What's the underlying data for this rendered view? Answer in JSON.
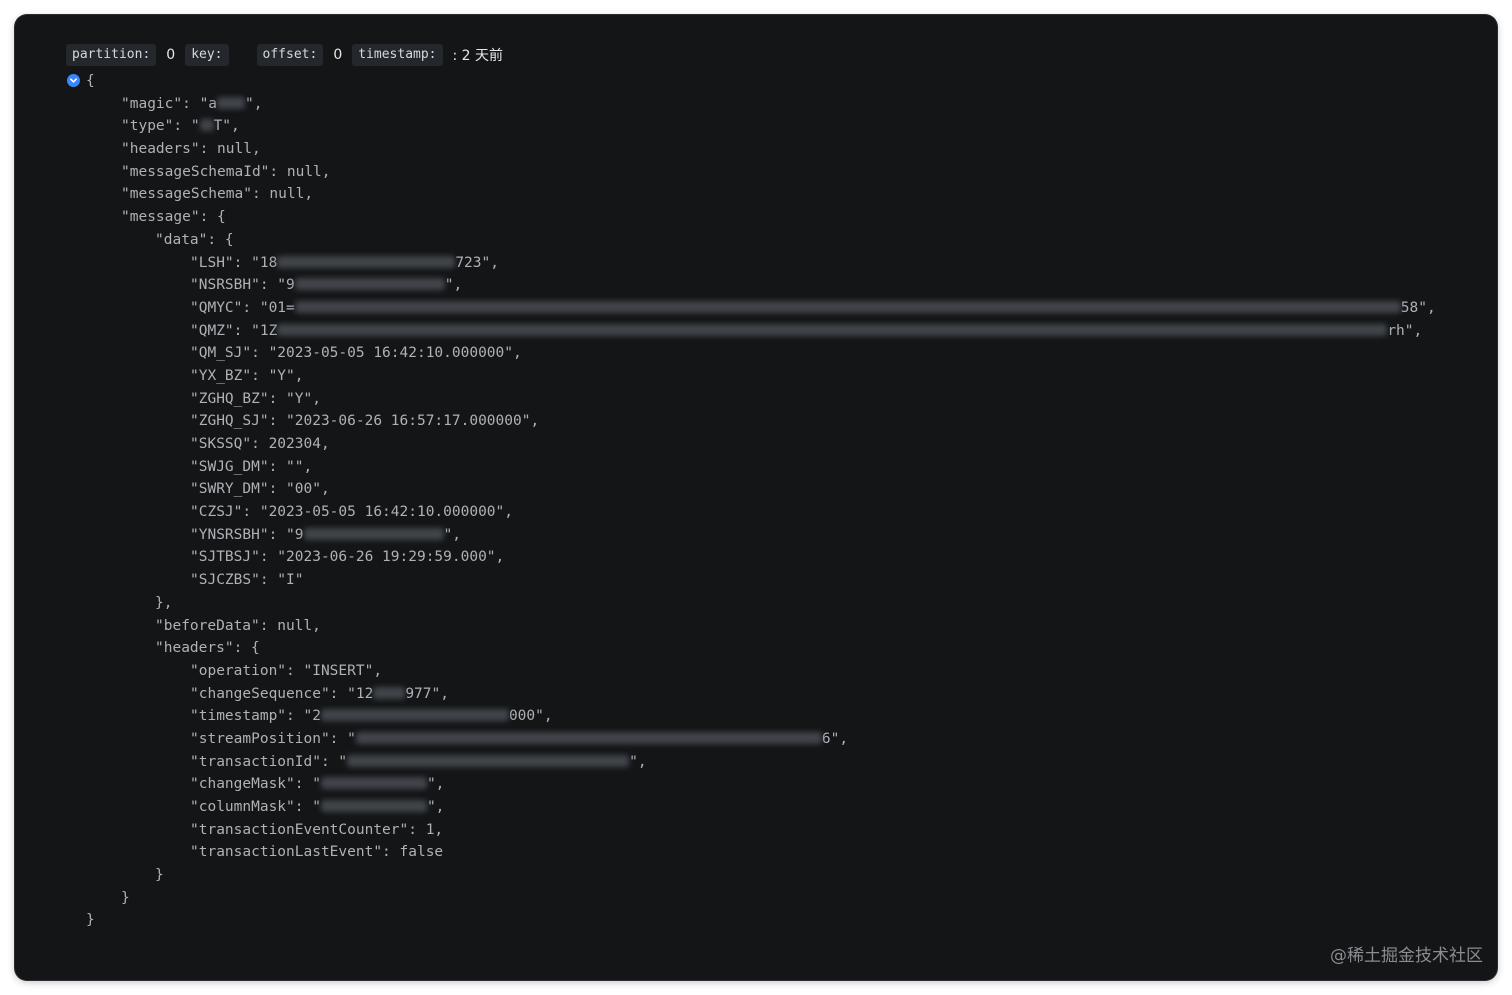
{
  "meta": {
    "partition_label": "partition:",
    "partition_value": "0",
    "key_label": "key:",
    "key_value": "",
    "offset_label": "offset:",
    "offset_value": "0",
    "timestamp_label": "timestamp:",
    "timestamp_value": ": 2 天前"
  },
  "toggle_icon": "chevron-down-icon",
  "json_lines": [
    {
      "indent": 0,
      "text": "{"
    },
    {
      "indent": 1,
      "text": "\"magic\": \"a",
      "redacted": true,
      "tail": "\","
    },
    {
      "indent": 1,
      "text": "\"type\": \"",
      "redacted": true,
      "tail": "T\","
    },
    {
      "indent": 1,
      "text": "\"headers\": null,"
    },
    {
      "indent": 1,
      "text": "\"messageSchemaId\": null,"
    },
    {
      "indent": 1,
      "text": "\"messageSchema\": null,"
    },
    {
      "indent": 1,
      "text": "\"message\": {"
    },
    {
      "indent": 2,
      "text": "\"data\": {"
    },
    {
      "indent": 3,
      "text": "\"LSH\": \"18",
      "redacted": true,
      "tail": "723\","
    },
    {
      "indent": 3,
      "text": "\"NSRSBH\": \"9",
      "redacted": true,
      "tail": "\","
    },
    {
      "indent": 3,
      "text": "\"QMYC\": \"01=",
      "redacted": true,
      "tail": "58\","
    },
    {
      "indent": 3,
      "text": "\"QMZ\": \"1Z",
      "redacted": true,
      "tail": "rh\","
    },
    {
      "indent": 3,
      "text": "\"QM_SJ\": \"2023-05-05 16:42:10.000000\","
    },
    {
      "indent": 3,
      "text": "\"YX_BZ\": \"Y\","
    },
    {
      "indent": 3,
      "text": "\"ZGHQ_BZ\": \"Y\","
    },
    {
      "indent": 3,
      "text": "\"ZGHQ_SJ\": \"2023-06-26 16:57:17.000000\","
    },
    {
      "indent": 3,
      "text": "\"SKSSQ\": 202304,"
    },
    {
      "indent": 3,
      "text": "\"SWJG_DM\": \"\","
    },
    {
      "indent": 3,
      "text": "\"SWRY_DM\": \"00\","
    },
    {
      "indent": 3,
      "text": "\"CZSJ\": \"2023-05-05 16:42:10.000000\","
    },
    {
      "indent": 3,
      "text": "\"YNSRSBH\": \"9",
      "redacted": true,
      "tail": "\","
    },
    {
      "indent": 3,
      "text": "\"SJTBSJ\": \"2023-06-26 19:29:59.000\","
    },
    {
      "indent": 3,
      "text": "\"SJCZBS\": \"I\""
    },
    {
      "indent": 2,
      "text": "},"
    },
    {
      "indent": 2,
      "text": "\"beforeData\": null,"
    },
    {
      "indent": 2,
      "text": "\"headers\": {"
    },
    {
      "indent": 3,
      "text": "\"operation\": \"INSERT\","
    },
    {
      "indent": 3,
      "text": "\"changeSequence\": \"12",
      "redacted": true,
      "tail": "977\","
    },
    {
      "indent": 3,
      "text": "\"timestamp\": \"2",
      "redacted": true,
      "tail": "000\","
    },
    {
      "indent": 3,
      "text": "\"streamPosition\": \"",
      "redacted": true,
      "tail": "6\","
    },
    {
      "indent": 3,
      "text": "\"transactionId\": \"",
      "redacted": true,
      "tail": "\","
    },
    {
      "indent": 3,
      "text": "\"changeMask\": \"",
      "redacted": true,
      "tail": "\","
    },
    {
      "indent": 3,
      "text": "\"columnMask\": \"",
      "redacted": true,
      "tail": "\","
    },
    {
      "indent": 3,
      "text": "\"transactionEventCounter\": 1,"
    },
    {
      "indent": 3,
      "text": "\"transactionLastEvent\": false"
    },
    {
      "indent": 2,
      "text": "}"
    },
    {
      "indent": 1,
      "text": "}"
    },
    {
      "indent": 0,
      "text": "}"
    }
  ],
  "watermark": "@稀土掘金技术社区"
}
